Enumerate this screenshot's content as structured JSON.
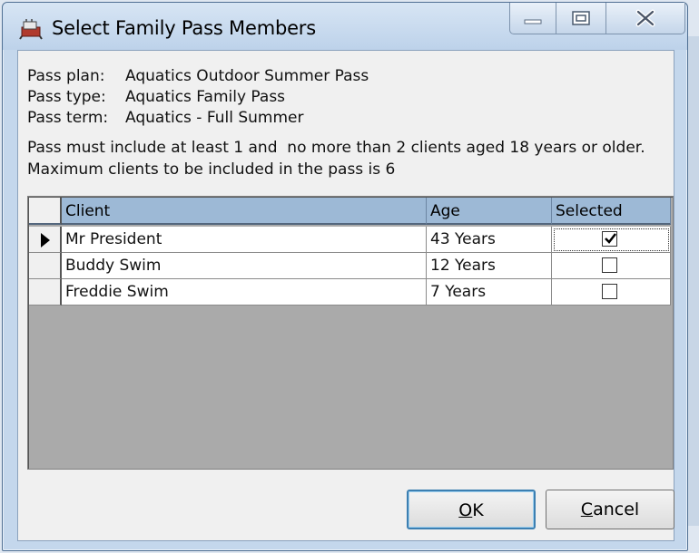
{
  "window": {
    "title": "Select Family Pass Members",
    "app_icon": "application-icon"
  },
  "caption_buttons": {
    "minimize_icon": "minimize-icon",
    "maximize_icon": "maximize-icon",
    "close_icon": "close-icon"
  },
  "pass": {
    "plan_label": "Pass plan:",
    "plan_value": "Aquatics Outdoor Summer Pass",
    "type_label": "Pass type:",
    "type_value": "Aquatics Family Pass",
    "term_label": "Pass term:",
    "term_value": "Aquatics - Full Summer"
  },
  "messages": {
    "line1": "Pass must include at least 1 and  no more than 2 clients aged 18 years or older.",
    "line2": "Maximum clients to be included in the pass is 6"
  },
  "grid": {
    "columns": [
      "Client",
      "Age",
      "Selected"
    ],
    "rows": [
      {
        "client": "Mr President",
        "age": "43 Years",
        "selected": true,
        "current": true
      },
      {
        "client": "Buddy Swim",
        "age": "12 Years",
        "selected": false,
        "current": false
      },
      {
        "client": "Freddie Swim",
        "age": "7 Years",
        "selected": false,
        "current": false
      }
    ]
  },
  "buttons": {
    "ok_accel": "O",
    "ok_rest": "K",
    "cancel_accel": "C",
    "cancel_rest": "ancel"
  }
}
